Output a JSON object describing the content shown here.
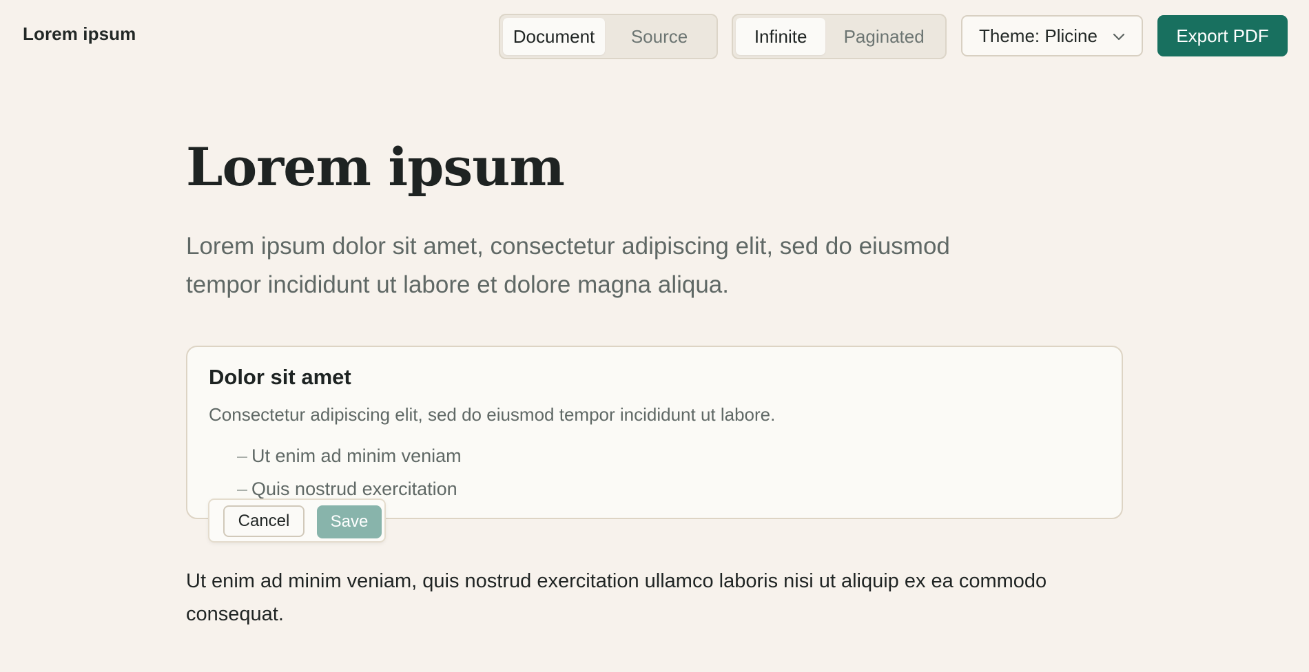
{
  "header": {
    "app_title": "Lorem ipsum",
    "view_tabs": [
      {
        "label": "Document",
        "active": true
      },
      {
        "label": "Source",
        "active": false
      }
    ],
    "layout_tabs": [
      {
        "label": "Infinite",
        "active": true
      },
      {
        "label": "Paginated",
        "active": false
      }
    ],
    "theme_select": {
      "value": "Theme: Plicine",
      "icon": "chevron-down-icon"
    },
    "export_label": "Export PDF"
  },
  "document": {
    "title": "Lorem ipsum",
    "subtitle": "Lorem ipsum dolor sit amet, consectetur adipiscing elit, sed do eiusmod tempor incididunt ut labore et dolore magna aliqua.",
    "card": {
      "title": "Dolor sit amet",
      "body": "Consectetur adipiscing elit, sed do eiusmod tempor incididunt ut labore.",
      "list_marker": "–",
      "items": [
        "Ut enim ad minim veniam",
        "Quis nostrud exercitation"
      ]
    },
    "edit_actions": {
      "cancel_label": "Cancel",
      "save_label": "Save"
    },
    "paragraph": "Ut enim ad minim veniam, quis nostrud exercitation ullamco laboris nisi ut aliquip ex ea commodo consequat."
  },
  "colors": {
    "background": "#f7f2ec",
    "accent": "#18705f",
    "save_disabled": "#88b4ab",
    "muted_text": "#5f6865"
  }
}
